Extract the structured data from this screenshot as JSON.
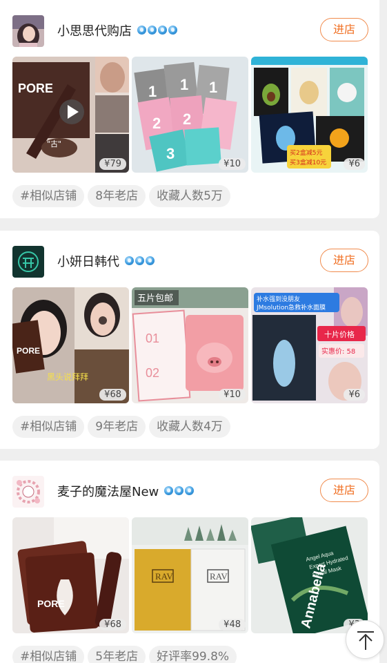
{
  "enter_label": "进店",
  "accent_color": "#f06d1f",
  "shops": [
    {
      "name": "小思思代购店",
      "badge_count": 4,
      "avatar_icon": "woman-portrait-avatar",
      "products": [
        {
          "price": "¥79",
          "image": "pore-nose-strip-product",
          "video": true
        },
        {
          "price": "¥10",
          "image": "step-1-2-3-nose-pack"
        },
        {
          "price": "¥6",
          "image": "jmsolution-mask-boxes",
          "promo": [
            "买2盒减5元",
            "买3盒减10元"
          ]
        }
      ],
      "tags": [
        "#相似店铺",
        "8年老店",
        "收藏人数5万"
      ]
    },
    {
      "name": "小妍日韩代",
      "badge_count": 3,
      "avatar_icon": "teal-shop-logo",
      "products": [
        {
          "price": "¥68",
          "image": "pore-blackhead-demo",
          "caption": "黑头说拜拜"
        },
        {
          "price": "¥10",
          "image": "pig-nose-strip-pack",
          "caption": "五片包邮"
        },
        {
          "price": "¥6",
          "image": "jmsolution-water-mask",
          "caption": "补水强到没朋友 JMsolution急救补水面膜",
          "promo": [
            "十片价格",
            "实惠价: 58"
          ]
        }
      ],
      "tags": [
        "#相似店铺",
        "9年老店",
        "收藏人数4万"
      ]
    },
    {
      "name": "麦子的魔法屋New",
      "badge_count": 3,
      "avatar_icon": "pink-floral-logo",
      "products": [
        {
          "price": "¥68",
          "image": "pore-nose-strips-stack"
        },
        {
          "price": "¥48",
          "image": "ray-facial-mask-boxes"
        },
        {
          "price": "¥3",
          "image": "annabella-facial-mask"
        }
      ],
      "tags": [
        "#相似店铺",
        "5年老店",
        "好评率99.8%"
      ]
    }
  ]
}
